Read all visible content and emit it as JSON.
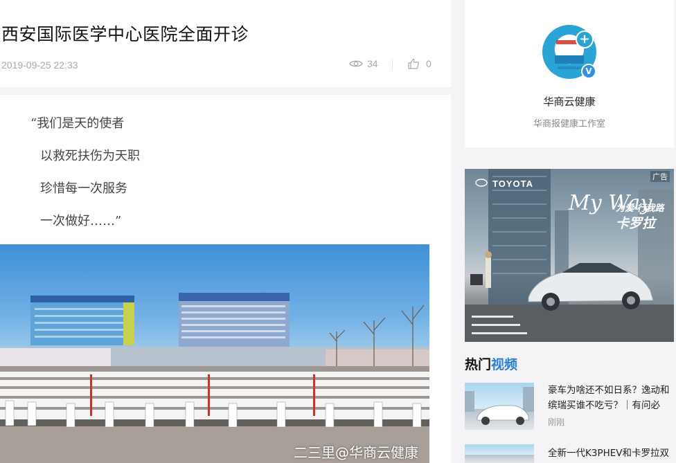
{
  "article": {
    "title": "西安国际医学中心医院全面开诊",
    "date": "2019-09-25 22:33",
    "views": "34",
    "likes": "0",
    "poem": [
      "“我们是天的使者",
      "以救死扶伤为天职",
      "珍惜每一次服务",
      "一次做好……”"
    ],
    "image_watermark": "二三里@华商云健康"
  },
  "author": {
    "name": "华商云健康",
    "description": "华商报健康工作室",
    "avatar_badge": "V",
    "avatar_plus": "+"
  },
  "ad": {
    "label": "广告",
    "brand": "TOYOTA",
    "headline": "My Way",
    "slogan": "为爱 行我路",
    "model": "卡罗拉"
  },
  "hot_videos": {
    "title_part1": "热门",
    "title_part2": "视频",
    "items": [
      {
        "title": "豪车为啥还不如日系？逸动和缤瑞买谁不吃亏？｜有问必",
        "meta": "刚刚"
      },
      {
        "title": "全新一代K3PHEV和卡罗拉双",
        "meta": ""
      }
    ]
  },
  "colors": {
    "accent": "#2b7fd6",
    "muted": "#a8a8a8",
    "background": "#f4f4f6"
  },
  "icons": [
    "eye-icon",
    "thumbs-up-icon",
    "verified-icon",
    "plus-icon"
  ]
}
